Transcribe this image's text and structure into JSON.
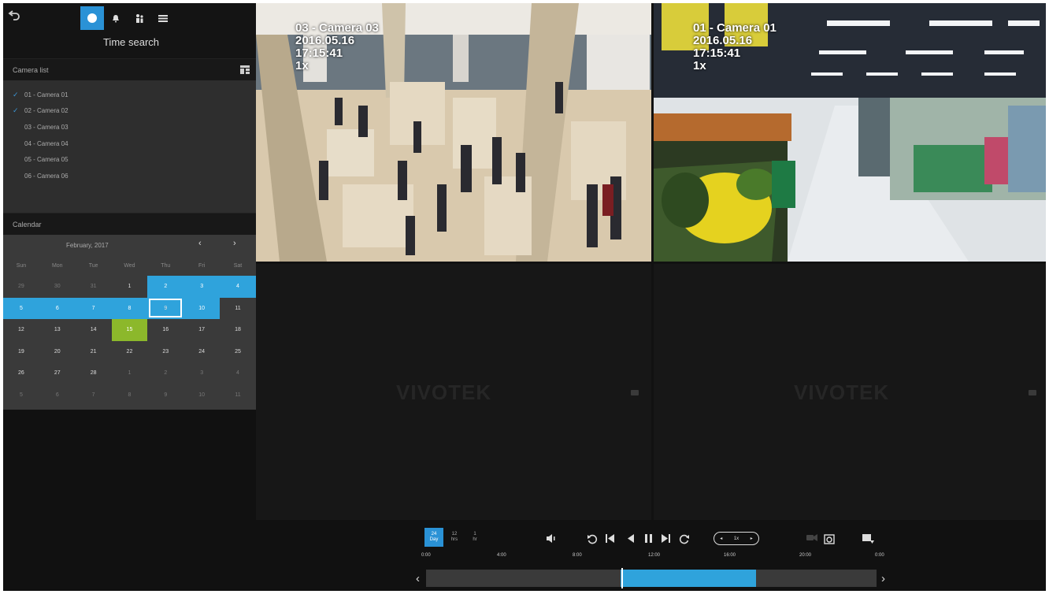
{
  "mode_title": "Time search",
  "camera_list": {
    "header": "Camera list",
    "items": [
      {
        "label": "01 - Camera 01",
        "checked": true
      },
      {
        "label": "02 - Camera 02",
        "checked": true
      },
      {
        "label": "03 - Camera 03",
        "checked": false
      },
      {
        "label": "04 - Camera 04",
        "checked": false
      },
      {
        "label": "05 - Camera 05",
        "checked": false
      },
      {
        "label": "06 - Camera 06",
        "checked": false
      }
    ]
  },
  "calendar": {
    "header": "Calendar",
    "month": "February, 2017",
    "prev": "‹",
    "next": "›",
    "weekdays": [
      "Sun",
      "Mon",
      "Tue",
      "Wed",
      "Thu",
      "Fri",
      "Sat"
    ],
    "days": [
      {
        "d": "29",
        "s": "other"
      },
      {
        "d": "30",
        "s": "other"
      },
      {
        "d": "31",
        "s": "other"
      },
      {
        "d": "1",
        "s": ""
      },
      {
        "d": "2",
        "s": "rec"
      },
      {
        "d": "3",
        "s": "rec"
      },
      {
        "d": "4",
        "s": "rec"
      },
      {
        "d": "5",
        "s": "rec"
      },
      {
        "d": "6",
        "s": "rec"
      },
      {
        "d": "7",
        "s": "rec"
      },
      {
        "d": "8",
        "s": "rec"
      },
      {
        "d": "9",
        "s": "selected"
      },
      {
        "d": "10",
        "s": "rec"
      },
      {
        "d": "11",
        "s": ""
      },
      {
        "d": "12",
        "s": ""
      },
      {
        "d": "13",
        "s": ""
      },
      {
        "d": "14",
        "s": ""
      },
      {
        "d": "15",
        "s": "today"
      },
      {
        "d": "16",
        "s": ""
      },
      {
        "d": "17",
        "s": ""
      },
      {
        "d": "18",
        "s": ""
      },
      {
        "d": "19",
        "s": ""
      },
      {
        "d": "20",
        "s": ""
      },
      {
        "d": "21",
        "s": ""
      },
      {
        "d": "22",
        "s": ""
      },
      {
        "d": "23",
        "s": ""
      },
      {
        "d": "24",
        "s": ""
      },
      {
        "d": "25",
        "s": ""
      },
      {
        "d": "26",
        "s": ""
      },
      {
        "d": "27",
        "s": ""
      },
      {
        "d": "28",
        "s": ""
      },
      {
        "d": "1",
        "s": "other"
      },
      {
        "d": "2",
        "s": "other"
      },
      {
        "d": "3",
        "s": "other"
      },
      {
        "d": "4",
        "s": "other"
      },
      {
        "d": "5",
        "s": "other"
      },
      {
        "d": "6",
        "s": "other"
      },
      {
        "d": "7",
        "s": "other"
      },
      {
        "d": "8",
        "s": "other"
      },
      {
        "d": "9",
        "s": "other"
      },
      {
        "d": "10",
        "s": "other"
      },
      {
        "d": "11",
        "s": "other"
      }
    ]
  },
  "tiles": {
    "cam3": {
      "name": "03 - Camera 03",
      "date": "2016.05.16",
      "time": "17:15:41",
      "speed": "1x"
    },
    "cam1": {
      "name": "01 - Camera 01",
      "date": "2016.05.16",
      "time": "17:15:41",
      "speed": "1x"
    },
    "empty_logo": "VIVOTEK"
  },
  "playback": {
    "ranges": [
      {
        "label": "24\nDay",
        "active": true
      },
      {
        "label": "12\nhrs",
        "active": false
      },
      {
        "label": "1\nhr",
        "active": false
      }
    ],
    "speed_label": "1x",
    "times": [
      "0:00",
      "4:00",
      "8:00",
      "12:00",
      "16:00",
      "20:00",
      "0:00"
    ],
    "timeline_left": "‹",
    "timeline_right": "›"
  },
  "colors": {
    "accent": "#2a92d6",
    "recorded": "#2fa3dc",
    "today": "#8cb82b"
  },
  "icons": [
    "back-icon",
    "playback-icon",
    "alarm-icon",
    "people-icon",
    "list-icon",
    "layout-icon",
    "volume-icon",
    "rewind-icon",
    "skip-start-icon",
    "step-back-icon",
    "pause-icon",
    "skip-end-icon",
    "forward-icon",
    "camera-off-icon",
    "snapshot-icon",
    "export-icon"
  ]
}
